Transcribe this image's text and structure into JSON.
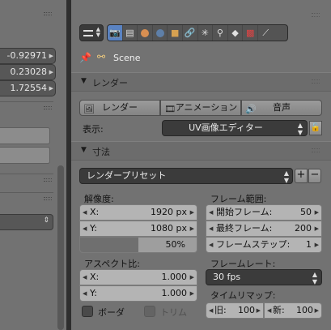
{
  "left_panel": {
    "values": [
      "-0.92971",
      "0.23028",
      "1.72554"
    ]
  },
  "toolbar": {
    "context_tabs": [
      "render",
      "render-layers",
      "scene",
      "world",
      "object",
      "constraints",
      "modifiers",
      "data",
      "material",
      "texture",
      "physics"
    ]
  },
  "breadcrumb": {
    "scene_label": "Scene"
  },
  "render_panel": {
    "title": "レンダー",
    "buttons": [
      "レンダー",
      "アニメーション",
      "音声"
    ],
    "display_label": "表示:",
    "display_value": "UV画像エディター"
  },
  "dimensions_panel": {
    "title": "寸法",
    "preset_value": "レンダープリセット",
    "resolution": {
      "label": "解像度:",
      "x_label": "X:",
      "x_value": "1920 px",
      "y_label": "Y:",
      "y_value": "1080 px",
      "percent_value": "50%",
      "percent_fraction": 0.5
    },
    "frame_range": {
      "label": "フレーム範囲:",
      "start_label": "開始フレーム:",
      "start_value": "50",
      "end_label": "最終フレーム:",
      "end_value": "200",
      "step_label": "フレームステップ:",
      "step_value": "1"
    },
    "aspect": {
      "label": "アスペクト比:",
      "x_label": "X:",
      "x_value": "1.000",
      "y_label": "Y:",
      "y_value": "1.000"
    },
    "frame_rate": {
      "label": "フレームレート:",
      "value": "30 fps"
    },
    "time_remap": {
      "label": "タイムリマップ:",
      "old_label": "旧:",
      "old_value": "100",
      "new_label": "新:",
      "new_value": "100"
    },
    "border_label": "ボーダ",
    "crop_label": "トリム"
  },
  "colors": {
    "active_tab": "#5a83c2",
    "panel_bg": "#727272",
    "header_bg": "#6c6c6c"
  }
}
